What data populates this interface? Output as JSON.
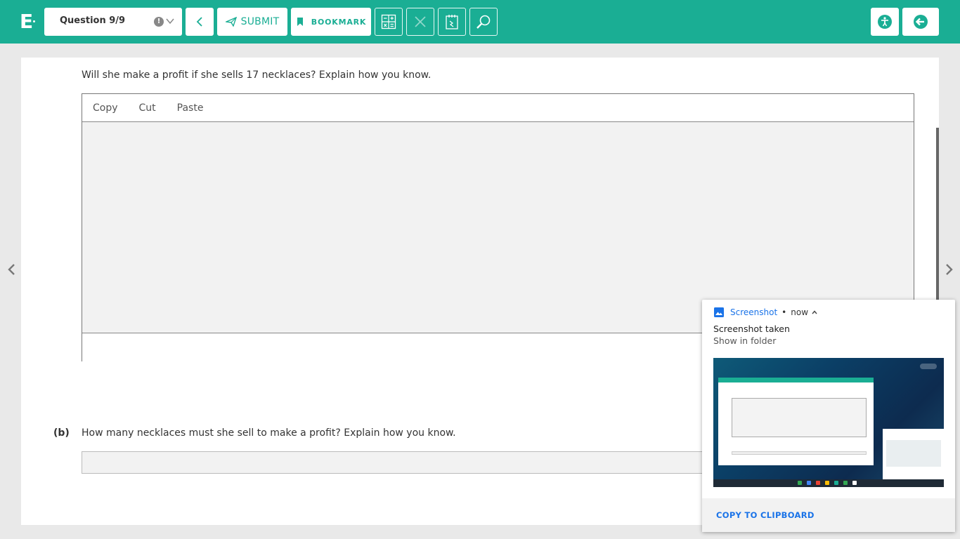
{
  "toolbar": {
    "logo_letter": "E",
    "question_select": "Question 9/9",
    "flag_glyph": "!",
    "submit_label": "SUBMIT",
    "bookmark_label": "BOOKMARK"
  },
  "question": {
    "part_a_prompt": "Will she make a profit if she sells 17 necklaces?  Explain how you know.",
    "editor_tools": [
      "Copy",
      "Cut",
      "Paste"
    ],
    "part_b_label": "(b)",
    "part_b_prompt": "How many necklaces must she sell to make a profit?  Explain how you know."
  },
  "notification": {
    "app_name": "Screenshot",
    "separator": "•",
    "time": "now",
    "title": "Screenshot taken",
    "subtitle": "Show in folder",
    "action": "COPY TO CLIPBOARD"
  },
  "colors": {
    "brand": "#1aae94",
    "link": "#1a73e8"
  },
  "icons": {
    "back": "chevron-left-icon",
    "submit": "paper-plane-icon",
    "bookmark": "bookmark-icon",
    "calculator": "calculator-icon",
    "close": "close-icon",
    "notepad": "notepad-icon",
    "search": "magnifier-icon",
    "accessibility": "accessibility-icon",
    "exit": "exit-arrow-icon"
  }
}
